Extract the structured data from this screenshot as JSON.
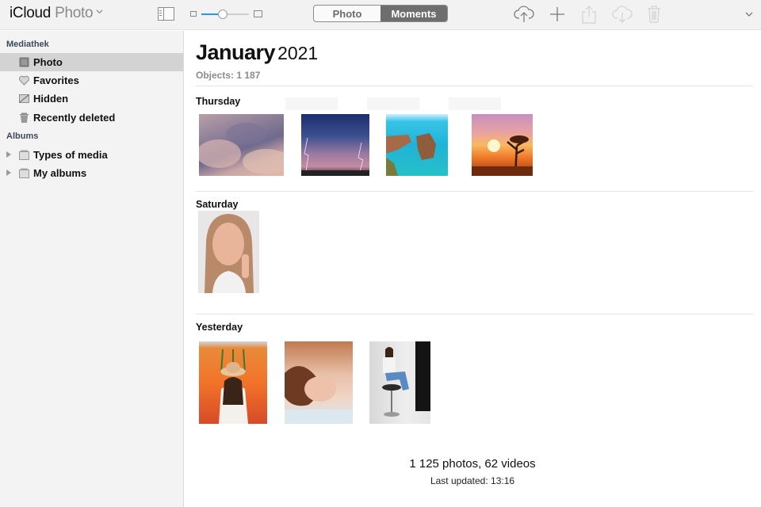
{
  "toolbar": {
    "brand": "iCloud",
    "section": "Photo",
    "view_toggle": {
      "options": [
        "Photo",
        "Moments"
      ],
      "selected": "Moments"
    },
    "zoom_level_percent": 45,
    "actions": [
      {
        "name": "upload-icon",
        "label": "Upload",
        "enabled": true
      },
      {
        "name": "add-icon",
        "label": "Add",
        "enabled": true
      },
      {
        "name": "share-icon",
        "label": "Share",
        "enabled": false
      },
      {
        "name": "download-icon",
        "label": "Download",
        "enabled": false
      },
      {
        "name": "trash-icon",
        "label": "Delete",
        "enabled": false
      }
    ],
    "accent_color": "#1d9bf0"
  },
  "sidebar": {
    "library_heading": "Mediathek",
    "library_items": [
      {
        "label": "Photo",
        "icon": "photos-icon",
        "selected": true
      },
      {
        "label": "Favorites",
        "icon": "heart-icon",
        "selected": false
      },
      {
        "label": "Hidden",
        "icon": "hidden-icon",
        "selected": false
      },
      {
        "label": "Recently deleted",
        "icon": "trash-icon",
        "selected": false
      }
    ],
    "albums_heading": "Albums",
    "album_items": [
      {
        "label": "Types of media",
        "icon": "album-stack-icon",
        "expanded": false
      },
      {
        "label": "My albums",
        "icon": "album-stack-icon",
        "expanded": false
      }
    ]
  },
  "main": {
    "month": "January",
    "year": "2021",
    "objects_label": "Objects: 1 187",
    "groups": [
      {
        "day": "Thursday",
        "photos": [
          "purple clouds",
          "lightning storm over city",
          "sea cliffs turquoise water",
          "sunset with tree silhouette"
        ]
      },
      {
        "day": "Saturday",
        "photos": [
          "portrait woman hand on cheek"
        ]
      },
      {
        "day": "Yesterday",
        "photos": [
          "woman with hat in tulip field",
          "woman lying on bed",
          "woman seated on bar stool"
        ]
      }
    ],
    "summary": "1 125 photos, 62 videos",
    "last_updated": "Last updated: 13:16"
  }
}
